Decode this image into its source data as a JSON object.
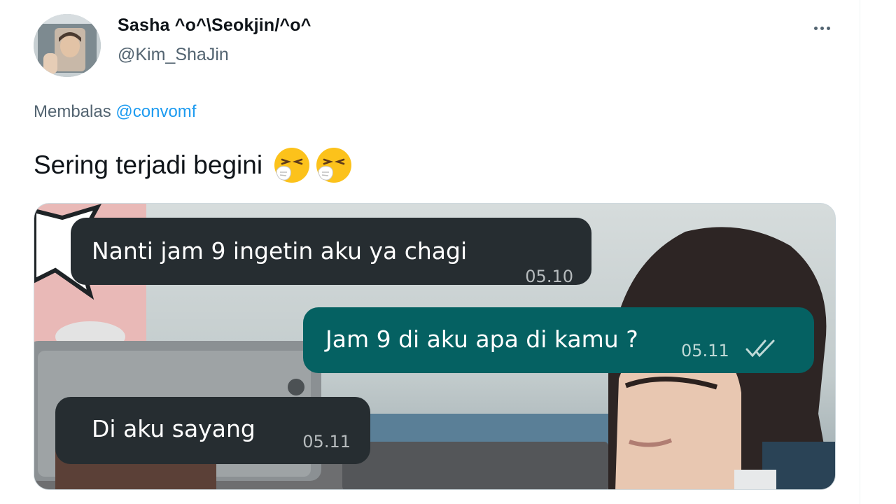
{
  "tweet": {
    "display_name": "Sasha ^o^\\Seokjin/^o^",
    "handle": "@Kim_ShaJin",
    "reply_prefix": "Membalas",
    "reply_mention": "@convomf",
    "text": "Sering terjadi begini",
    "emoji": [
      "sneezing-face-emoji",
      "sneezing-face-emoji"
    ],
    "more_icon": "more-options-icon"
  },
  "chat": {
    "messages": [
      {
        "direction": "incoming",
        "text": "Nanti jam 9 ingetin aku ya chagi",
        "time": "05.10"
      },
      {
        "direction": "outgoing",
        "text": "Jam 9 di aku apa di kamu ?",
        "time": "05.11",
        "status_icon": "double-check-icon"
      },
      {
        "direction": "incoming",
        "text": "Di aku sayang",
        "time": "05.11"
      }
    ]
  },
  "colors": {
    "incoming_bubble": "#262d31",
    "outgoing_bubble": "#056162",
    "mention": "#1d9bf0"
  }
}
